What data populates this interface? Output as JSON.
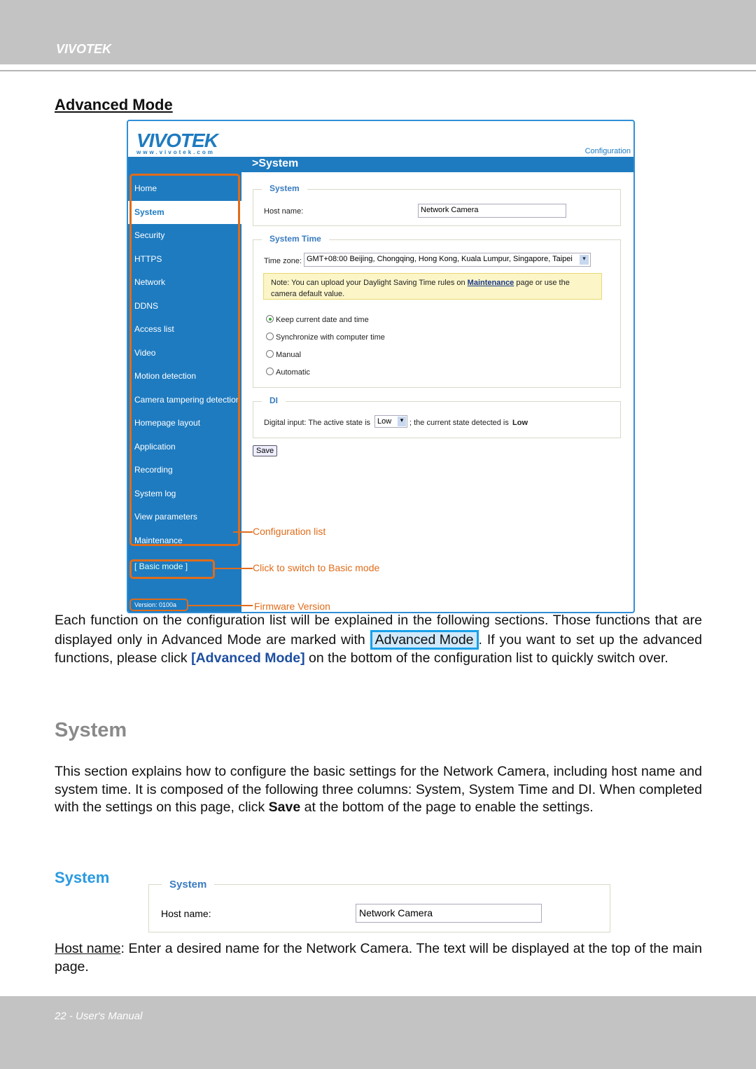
{
  "header": {
    "brand": "VIVOTEK"
  },
  "footer": {
    "text": "22 - User's Manual"
  },
  "advanced_mode": {
    "title": "Advanced Mode"
  },
  "screenshot": {
    "logo": "VIVOTEK",
    "logo_url": "www.vivotek.com",
    "config_link": "Configuration",
    "page_heading": ">System",
    "nav": [
      "Home",
      "System",
      "Security",
      "HTTPS",
      "Network",
      "DDNS",
      "Access list",
      "Video",
      "Motion detection",
      "Camera tampering detection",
      "Homepage layout",
      "Application",
      "Recording",
      "System log",
      "View parameters",
      "Maintenance"
    ],
    "active_nav": "System",
    "basic_mode": "[ Basic mode ]",
    "version": "Version: 0100a",
    "system": {
      "legend": "System",
      "host_label": "Host name:",
      "host_value": "Network Camera"
    },
    "system_time": {
      "legend": "System Time",
      "tz_label": "Time zone:",
      "tz_value": "GMT+08:00 Beijing, Chongqing, Hong Kong, Kuala Lumpur, Singapore, Taipei",
      "note_pre": "Note: You can upload your Daylight Saving Time rules on ",
      "note_link": "Maintenance",
      "note_post": " page or use the camera default value.",
      "options": [
        "Keep current date and time",
        "Synchronize with computer time",
        "Manual",
        "Automatic"
      ],
      "selected": 0
    },
    "di": {
      "legend": "DI",
      "pre": "Digital input: The active state is",
      "select": "Low",
      "mid": "; the current state detected is",
      "state": "Low"
    },
    "save": "Save",
    "annotations": {
      "config_list": "Configuration list",
      "basic": "Click to switch to Basic mode",
      "firmware": "Firmware Version"
    }
  },
  "intro": {
    "p1": "Each function on the configuration list will be explained in the following sections. Those functions that are displayed only in Advanced Mode are marked with ",
    "badge": "Advanced Mode",
    "p2": ". If you want to set up the advanced functions, please click ",
    "link": "[Advanced Mode]",
    "p3": " on the bottom of the configuration list to quickly switch over."
  },
  "system_section": {
    "title": "System",
    "p_a": "This section explains how to configure the basic settings for the Network Camera, including host name and system time. It is composed of the following three columns: System, System Time and DI. When completed with the settings on this page, click ",
    "p_bold": "Save",
    "p_b": " at the bottom of the page to enable the settings.",
    "sub": "System",
    "legend": "System",
    "host_label": "Host name:",
    "host_value": "Network Camera",
    "desc_term": "Host name",
    "desc": ": Enter a desired name for the Network Camera. The text will be displayed at the top of the main page."
  }
}
